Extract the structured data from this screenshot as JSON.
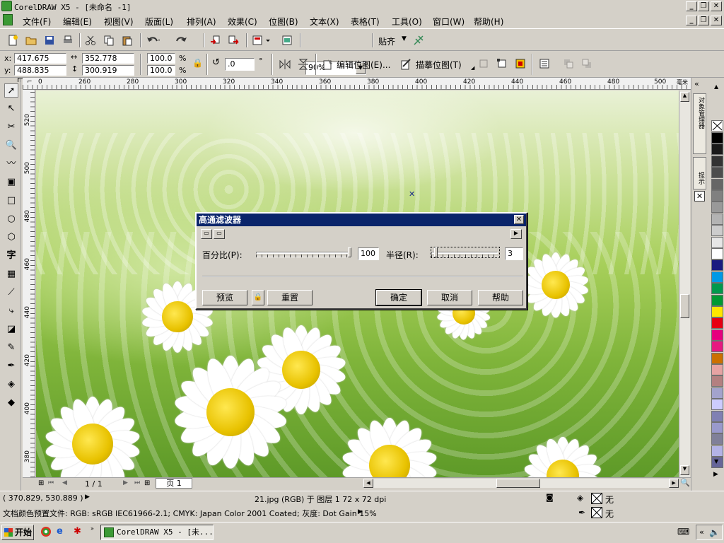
{
  "window": {
    "title": "CorelDRAW X5 - [未命名 -1]"
  },
  "menu": [
    "文件(F)",
    "编辑(E)",
    "视图(V)",
    "版面(L)",
    "排列(A)",
    "效果(C)",
    "位图(B)",
    "文本(X)",
    "表格(T)",
    "工具(O)",
    "窗口(W)",
    "帮助(H)"
  ],
  "toolbar1": {
    "zoom": "90%",
    "snap_label": "贴齐"
  },
  "propbar": {
    "x_label": "x:",
    "x_value": "417.675 mm",
    "y_label": "y:",
    "y_value": "488.835 mm",
    "w_value": "352.778 mm",
    "h_value": "300.919 mm",
    "scale_x": "100.0",
    "scale_y": "100.0",
    "pct": "%",
    "rotation": ".0",
    "deg": "°",
    "edit_bitmap": "编辑位图(E)...",
    "trace_bitmap": "描摹位图(T)"
  },
  "ruler": {
    "unit": "毫米",
    "top_ticks": [
      "0",
      "260",
      "280",
      "300",
      "320",
      "340",
      "360",
      "380",
      "400",
      "420",
      "440",
      "460",
      "480",
      "500",
      "520"
    ],
    "left_ticks": [
      "520",
      "500",
      "480",
      "460",
      "440",
      "420",
      "400",
      "380"
    ]
  },
  "dialog": {
    "title": "高通滤波器",
    "percent_label": "百分比(P):",
    "percent_value": "100",
    "percent_level": 1.0,
    "radius_label": "半径(R):",
    "radius_value": "3",
    "buttons": {
      "preview": "预览",
      "reset": "重置",
      "ok": "确定",
      "cancel": "取消",
      "help": "帮助"
    }
  },
  "page_nav": {
    "counter": "1 / 1",
    "tab": "页 1"
  },
  "docker": {
    "tab1": "对象管理器",
    "tab2": "提示"
  },
  "palette": [
    "#ffffff",
    "#000000",
    "#1a1a1a",
    "#333333",
    "#4d4d4d",
    "#666666",
    "#808080",
    "#999999",
    "#b3b3b3",
    "#cccccc",
    "#e6e6e6",
    "#ffffff",
    "#1a1a80",
    "#0099e6",
    "#00994d",
    "#009933",
    "#ffe600",
    "#e60012",
    "#e6007e",
    "#e61980",
    "#cc7000",
    "#e6a3a3",
    "#b38080",
    "#a3a3cc",
    "#ccccff",
    "#8080b3",
    "#9999cc",
    "#808099",
    "#b3b3e6",
    "#666699"
  ],
  "status": {
    "coords": "( 370.829, 530.889 )",
    "object_info": "21.jpg (RGB) 于 图层 1 72 x 72 dpi",
    "fill_label": "无",
    "outline_label": "无",
    "color_profile": "文档颜色预置文件: RGB: sRGB IEC61966-2.1; CMYK: Japan Color 2001 Coated; 灰度: Dot Gain 15%"
  },
  "taskbar": {
    "start": "开始",
    "task": "CorelDRAW X5 - [未..."
  }
}
